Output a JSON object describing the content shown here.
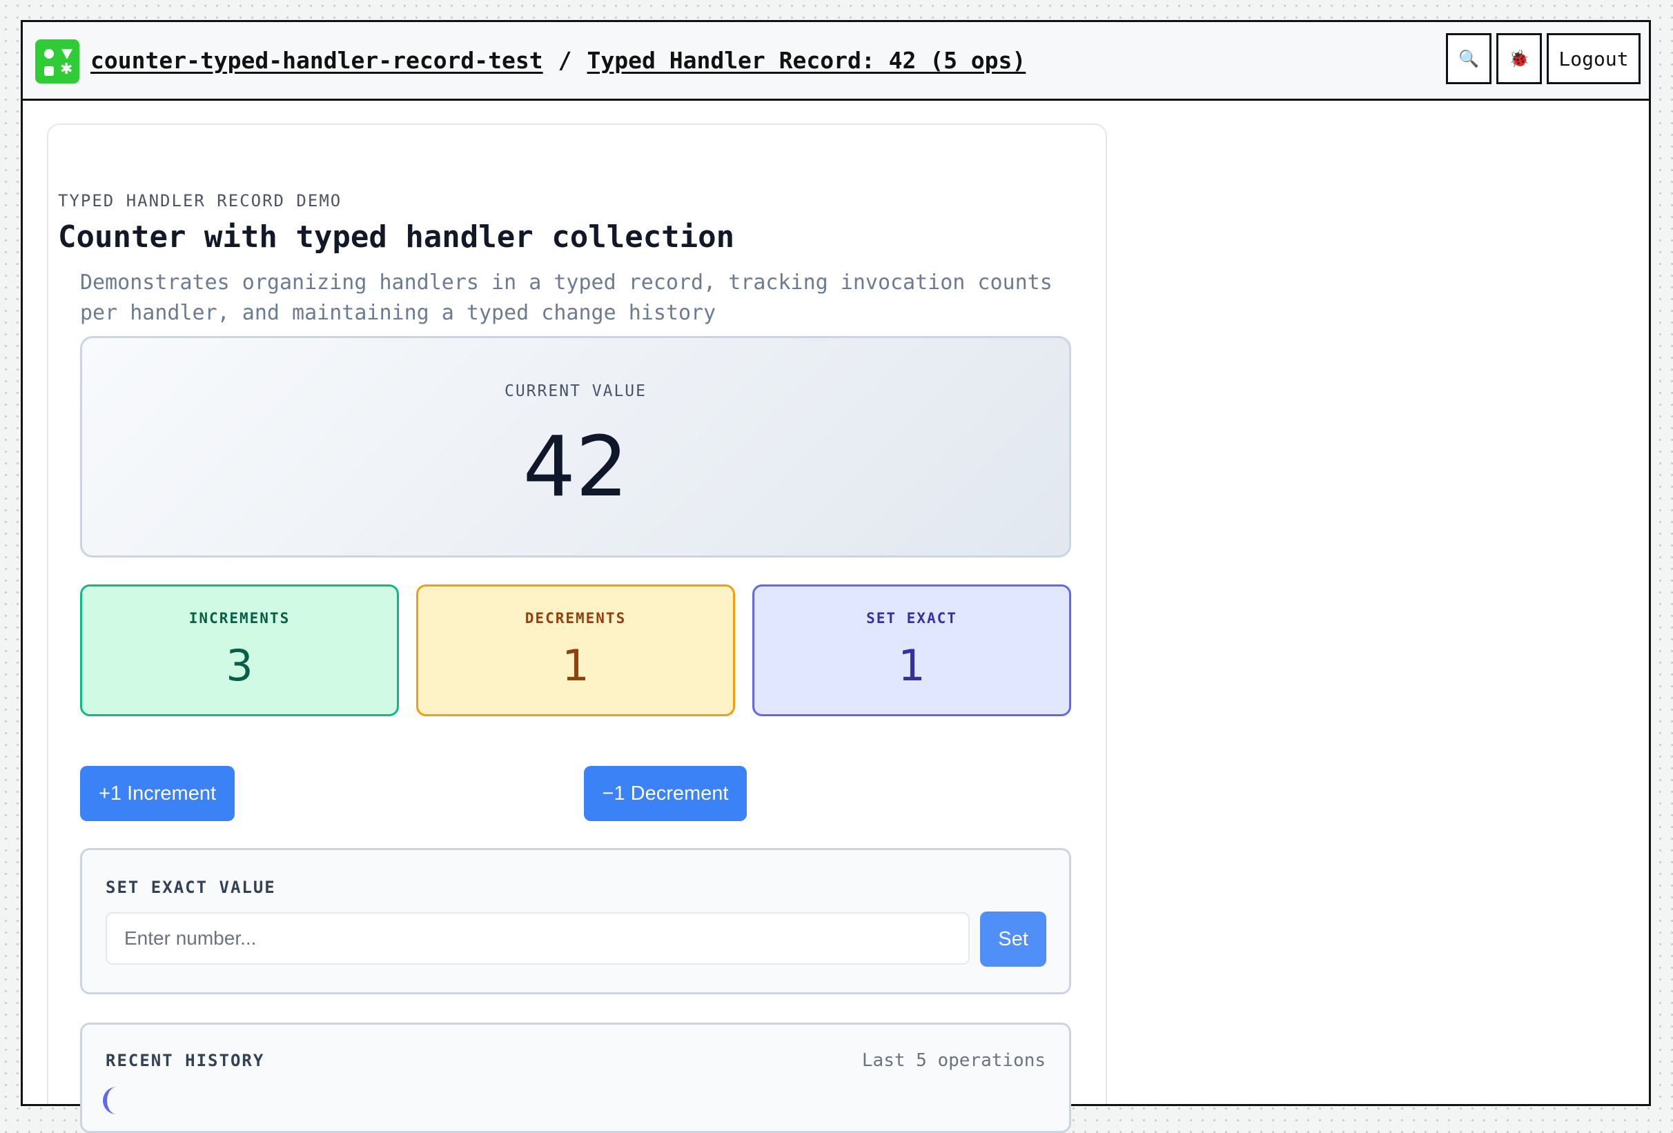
{
  "header": {
    "space_name": "counter-typed-handler-record-test",
    "separator": "/",
    "page_title": "Typed Handler Record: 42 (5 ops)",
    "search_icon": "🔍",
    "debug_icon": "🐞",
    "logout_label": "Logout"
  },
  "demo": {
    "eyebrow": "TYPED HANDLER RECORD DEMO",
    "title": "Counter with typed handler collection",
    "description": "Demonstrates organizing handlers in a typed record, tracking invocation counts per handler, and maintaining a typed change history"
  },
  "current": {
    "label": "CURRENT VALUE",
    "value": "42"
  },
  "stats": [
    {
      "label": "INCREMENTS",
      "value": "3",
      "color": "#065f46",
      "bg": "#d1fae5",
      "border": "#10b981"
    },
    {
      "label": "DECREMENTS",
      "value": "1",
      "color": "#92400e",
      "bg": "#fef3c7",
      "border": "#f59e0b"
    },
    {
      "label": "SET EXACT",
      "value": "1",
      "color": "#3730a3",
      "bg": "#e0e7ff",
      "border": "#6366f1"
    }
  ],
  "actions": {
    "increment_label": "+1 Increment",
    "decrement_label": "−1 Decrement"
  },
  "set_exact": {
    "heading": "SET EXACT VALUE",
    "placeholder": "Enter number...",
    "button_label": "Set"
  },
  "history": {
    "heading": "RECENT HISTORY",
    "note": "Last 5 operations"
  },
  "colors": {
    "accent": "#3b82f6",
    "logo": "#2fcc35"
  }
}
